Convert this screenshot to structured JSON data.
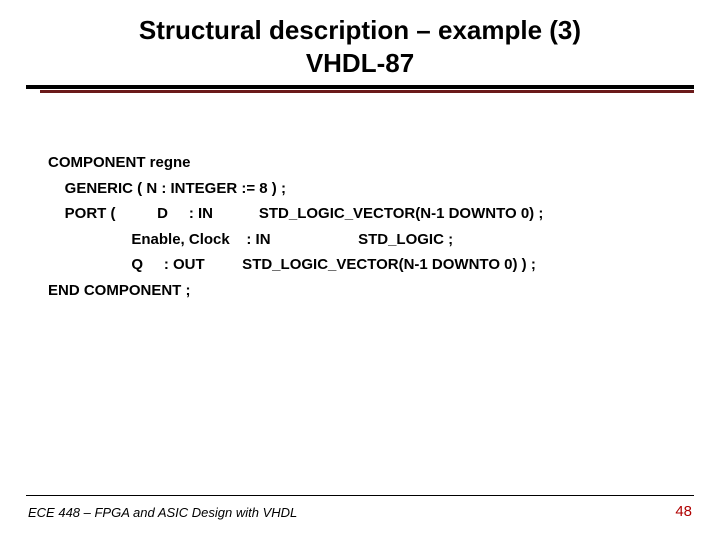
{
  "title_line1": "Structural description – example (3)",
  "title_line2": "VHDL-87",
  "code": {
    "l1": "COMPONENT regne",
    "l2": "    GENERIC ( N : INTEGER := 8 ) ;",
    "l3": "    PORT (          D     : IN           STD_LOGIC_VECTOR(N-1 DOWNTO 0) ;",
    "l4": "                    Enable, Clock    : IN                     STD_LOGIC ;",
    "l5": "                    Q     : OUT         STD_LOGIC_VECTOR(N-1 DOWNTO 0) ) ;",
    "l6": "END COMPONENT ;"
  },
  "footer_left": "ECE 448 – FPGA and ASIC Design with VHDL",
  "page_number": "48"
}
